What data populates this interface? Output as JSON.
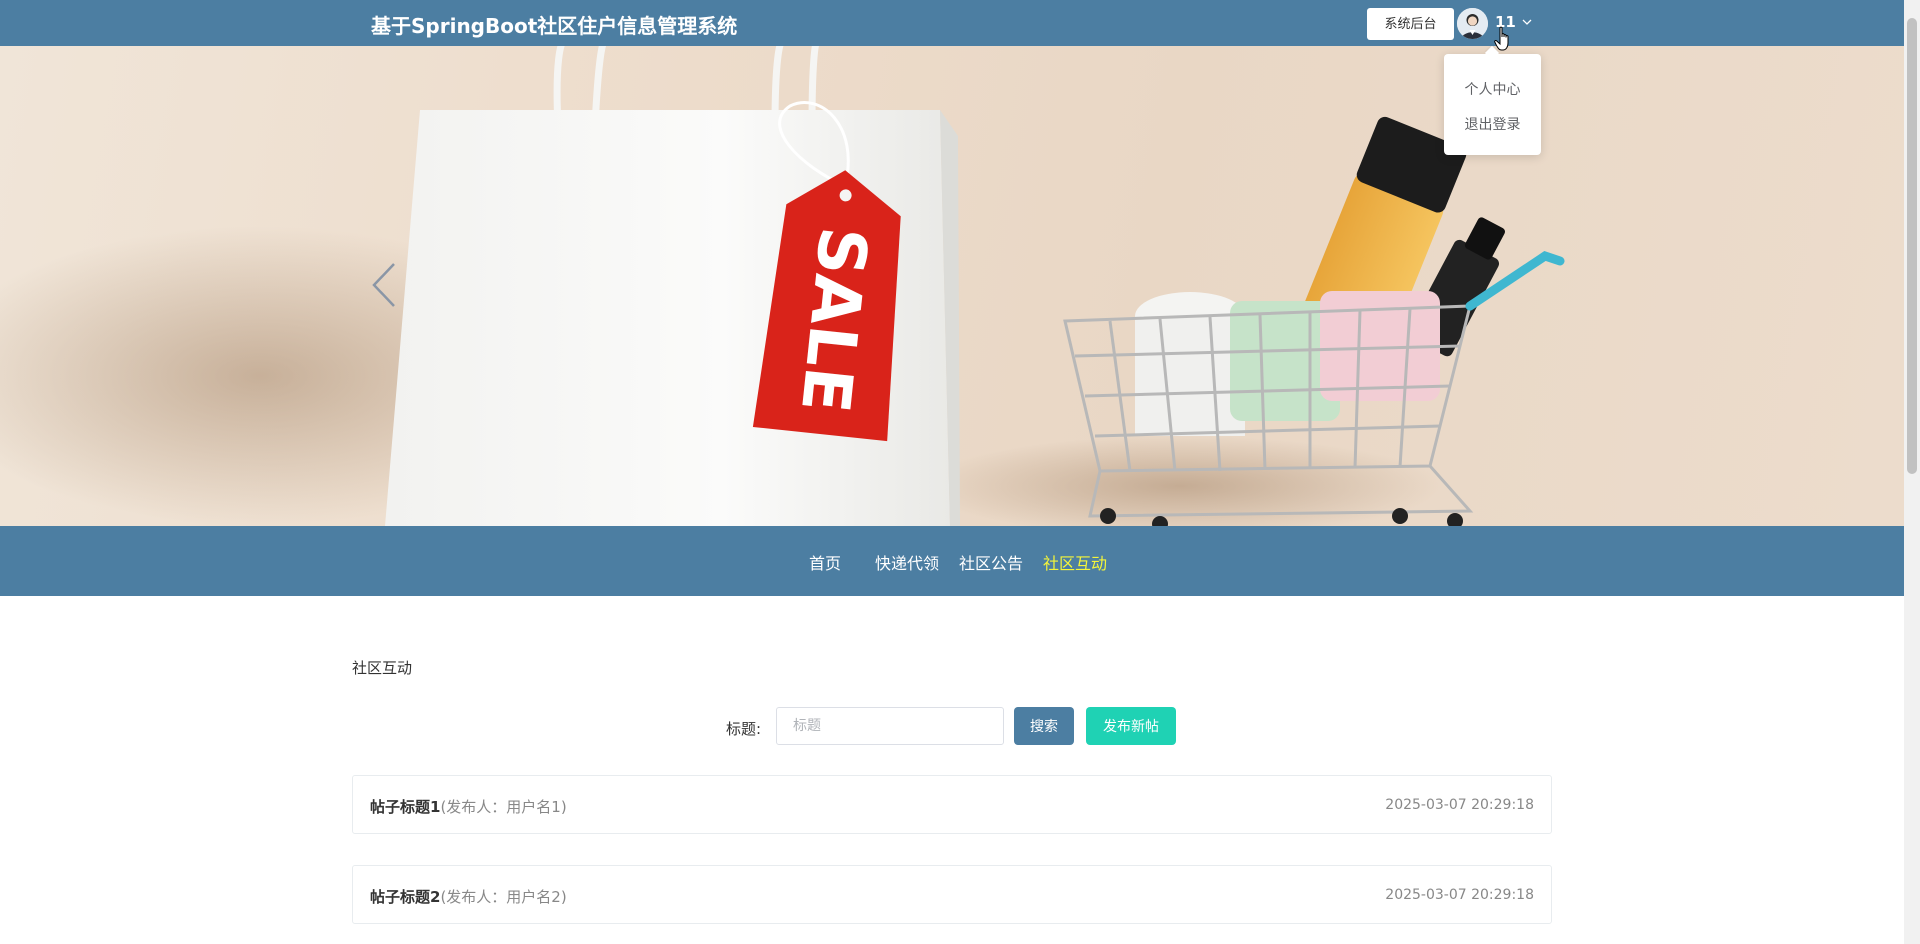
{
  "header": {
    "site_title": "基于SpringBoot社区住户信息管理系统",
    "admin_button": "系统后台",
    "username": "11"
  },
  "user_menu": {
    "items": [
      {
        "label": "个人中心"
      },
      {
        "label": "退出登录"
      }
    ]
  },
  "banner": {
    "tag_text": "SALE"
  },
  "nav": {
    "items": [
      {
        "label": "首页",
        "active": false
      },
      {
        "label": "快递代领",
        "active": false
      },
      {
        "label": "社区公告",
        "active": false
      },
      {
        "label": "社区互动",
        "active": true
      }
    ]
  },
  "content": {
    "breadcrumb": "社区互动",
    "search": {
      "label": "标题:",
      "placeholder": "标题",
      "value": ""
    },
    "search_button": "搜索",
    "new_post_button": "发布新帖",
    "posts": [
      {
        "title": "帖子标题1",
        "author": "(发布人：用户名1)",
        "date": "2025-03-07 20:29:18"
      },
      {
        "title": "帖子标题2",
        "author": "(发布人：用户名2)",
        "date": "2025-03-07 20:29:18"
      }
    ]
  },
  "colors": {
    "primary": "#4c7ea2",
    "active_nav": "#f4f53a",
    "accent_button": "#1fd2b4",
    "sale_tag": "#d9231a"
  }
}
